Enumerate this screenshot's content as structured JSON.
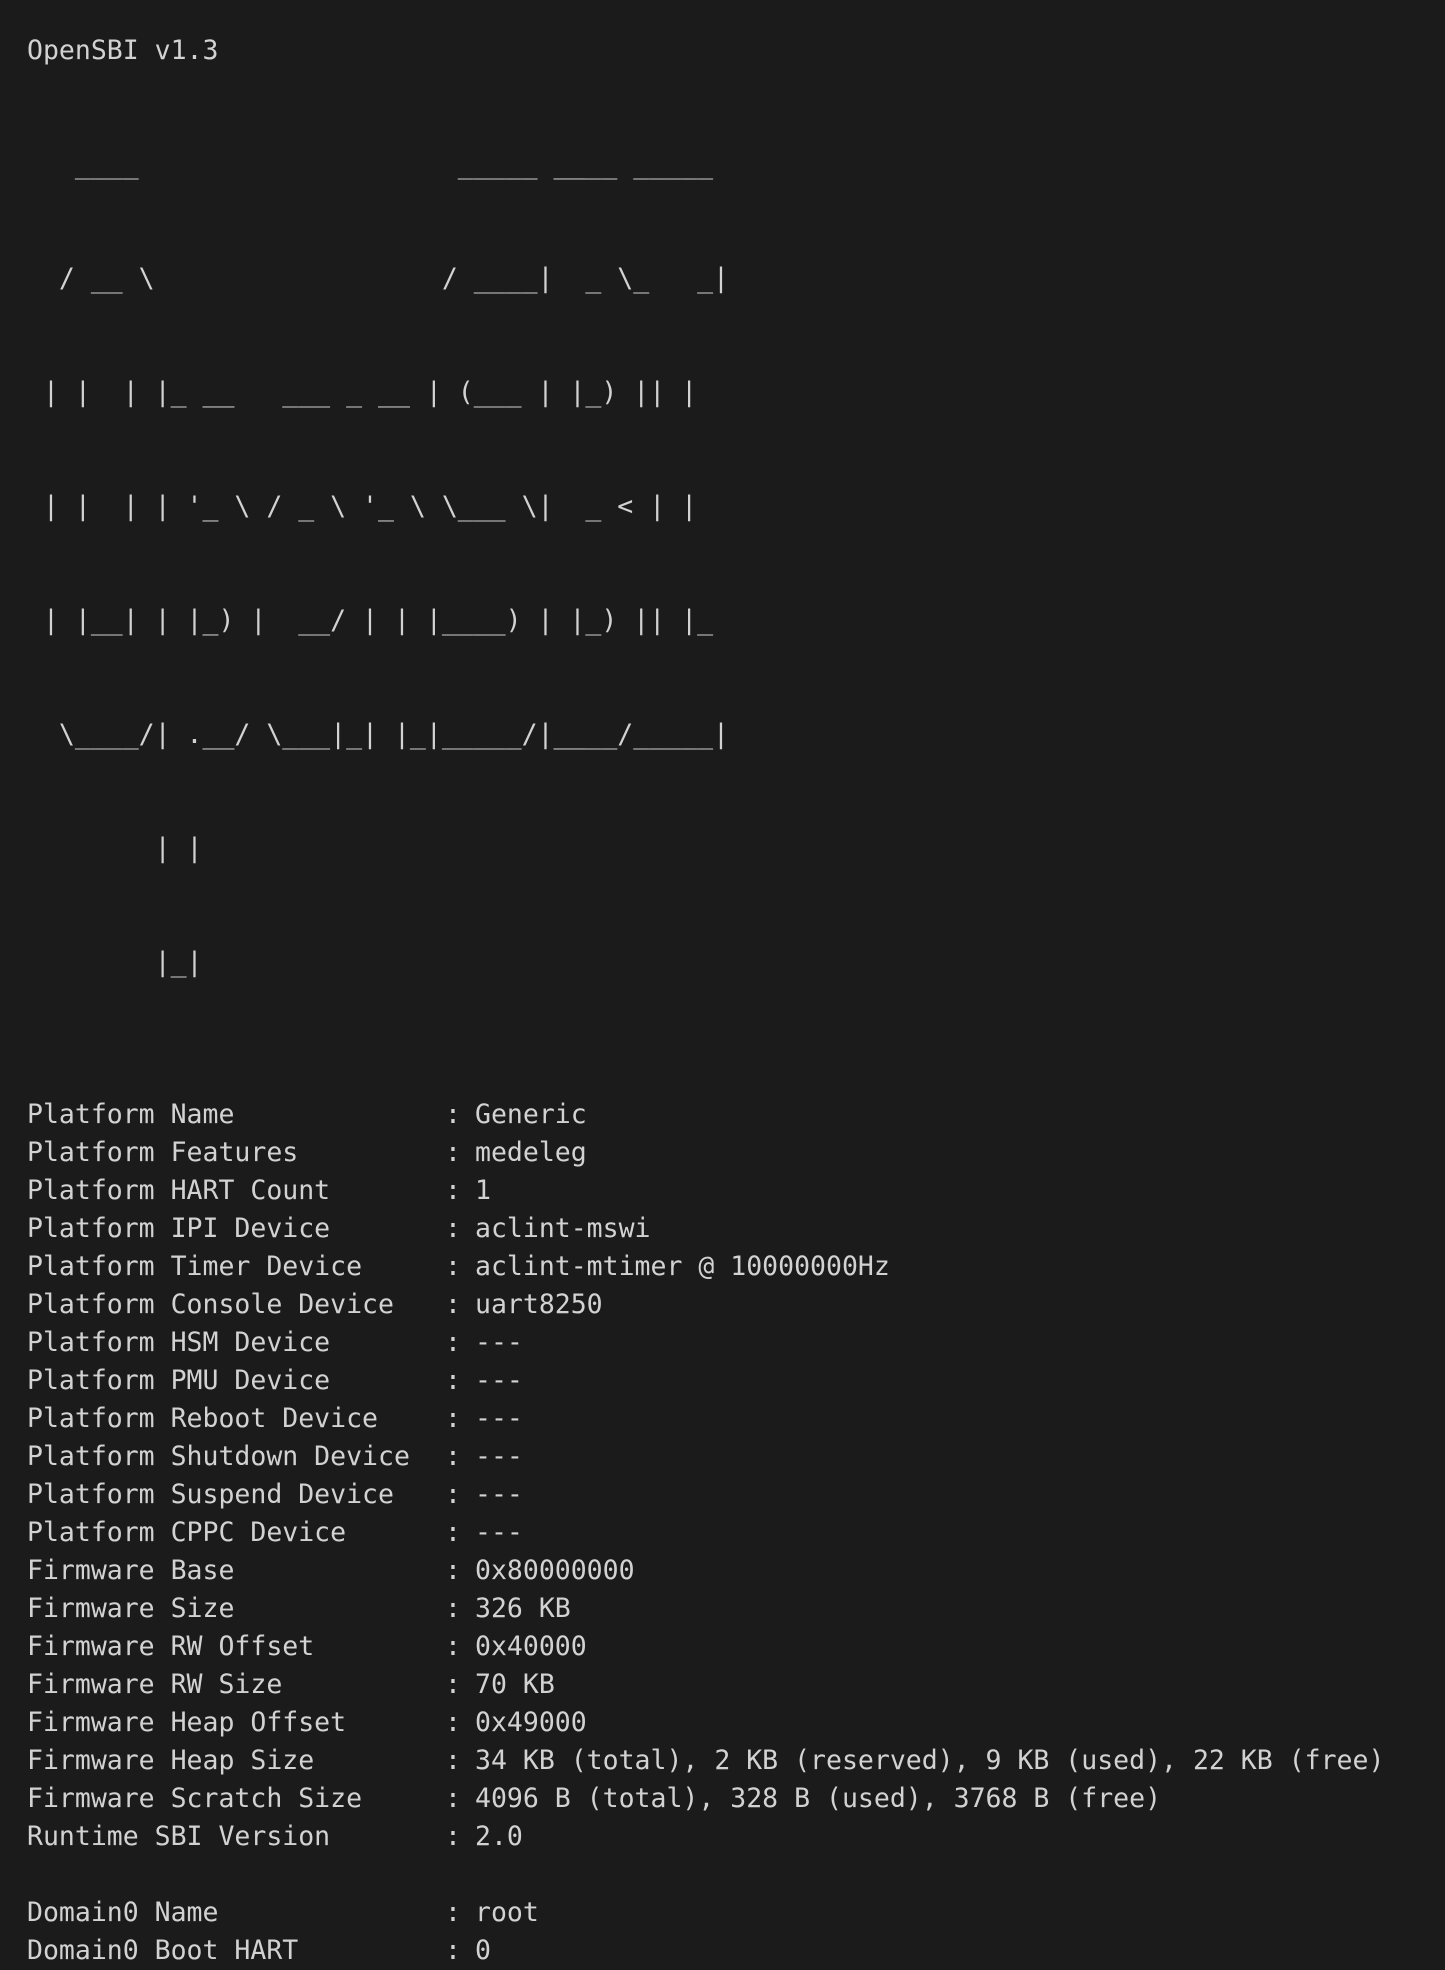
{
  "terminal": {
    "title": "OpenSBI v1.3",
    "logo_lines": [
      "   ____                    _____ ____ _____",
      "  / __ \\                  / ____|  _ \\_   _|",
      " | |  | |_ __   ___ _ __ | (___ | |_) || |",
      " | |  | | '_ \\ / _ \\ '_ \\ \\___ \\|  _ < | |",
      " | |__| | |_) |  __/ | | |____) | |_) || |_",
      "  \\____/| .__/ \\___|_| |_|_____/|____/_____|",
      "        | |",
      "        |_|"
    ],
    "separator": ":",
    "platform_info": [
      {
        "key": "Platform Name",
        "value": "Generic"
      },
      {
        "key": "Platform Features",
        "value": "medeleg"
      },
      {
        "key": "Platform HART Count",
        "value": "1"
      },
      {
        "key": "Platform IPI Device",
        "value": "aclint-mswi"
      },
      {
        "key": "Platform Timer Device",
        "value": "aclint-mtimer @ 10000000Hz"
      },
      {
        "key": "Platform Console Device",
        "value": "uart8250"
      },
      {
        "key": "Platform HSM Device",
        "value": "---"
      },
      {
        "key": "Platform PMU Device",
        "value": "---"
      },
      {
        "key": "Platform Reboot Device",
        "value": "---"
      },
      {
        "key": "Platform Shutdown Device",
        "value": "---"
      },
      {
        "key": "Platform Suspend Device",
        "value": "---"
      },
      {
        "key": "Platform CPPC Device",
        "value": "---"
      },
      {
        "key": "Firmware Base",
        "value": "0x80000000"
      },
      {
        "key": "Firmware Size",
        "value": "326 KB"
      },
      {
        "key": "Firmware RW Offset",
        "value": "0x40000"
      },
      {
        "key": "Firmware RW Size",
        "value": "70 KB"
      },
      {
        "key": "Firmware Heap Offset",
        "value": "0x49000"
      },
      {
        "key": "Firmware Heap Size",
        "value": "34 KB (total), 2 KB (reserved), 9 KB (used), 22 KB (free)"
      },
      {
        "key": "Firmware Scratch Size",
        "value": "4096 B (total), 328 B (used), 3768 B (free)"
      },
      {
        "key": "Runtime SBI Version",
        "value": "2.0"
      }
    ],
    "domain_info": [
      {
        "key": "Domain0 Name",
        "value": "root"
      },
      {
        "key": "Domain0 Boot HART",
        "value": "0"
      }
    ],
    "colors": {
      "background": "#1b1b1b",
      "foreground": "#d2d2d2"
    }
  }
}
